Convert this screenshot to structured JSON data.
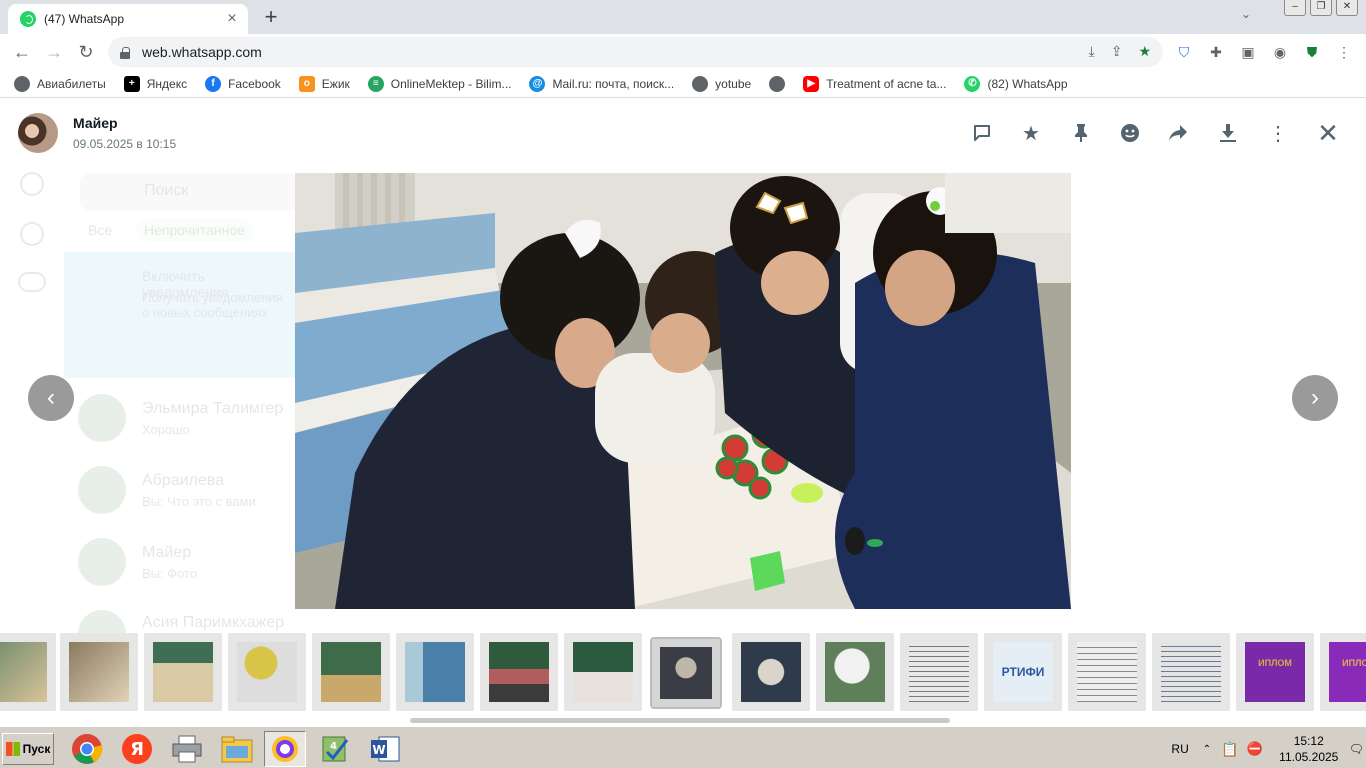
{
  "browser": {
    "tab_title": "(47) WhatsApp",
    "url": "web.whatsapp.com",
    "window_controls": [
      "minimize",
      "restore",
      "close"
    ]
  },
  "bookmarks": [
    {
      "label": "Авиабилеты",
      "icon": "globe-icon",
      "color": "#5f6368"
    },
    {
      "label": "Яндекс",
      "icon": "yandex-icon",
      "color": "#000000"
    },
    {
      "label": "Facebook",
      "icon": "facebook-icon",
      "color": "#1877f2"
    },
    {
      "label": "Ежик",
      "icon": "odnoklassniki-icon",
      "color": "#f7931e"
    },
    {
      "label": "OnlineMektep - Bilim...",
      "icon": "onlinemektep-icon",
      "color": "#25a55f"
    },
    {
      "label": "Mail.ru: почта, поиск...",
      "icon": "mailru-icon",
      "color": "#168de2"
    },
    {
      "label": "yotube",
      "icon": "globe-icon",
      "color": "#5f6368"
    },
    {
      "label": "",
      "icon": "globe-icon",
      "color": "#5f6368"
    },
    {
      "label": "Treatment of acne ta...",
      "icon": "youtube-icon",
      "color": "#ff0000"
    },
    {
      "label": "(82) WhatsApp",
      "icon": "whatsapp-icon",
      "color": "#25d366"
    }
  ],
  "viewer": {
    "sender": "Майер",
    "datetime": "09.05.2025 в 10:15",
    "actions": [
      "reply-icon",
      "star-icon",
      "pin-icon",
      "emoji-icon",
      "forward-icon",
      "download-icon",
      "menu-icon",
      "close-icon"
    ]
  },
  "background_chat": {
    "search_placeholder": "Поиск",
    "filters": [
      "Все",
      "Непрочитанное"
    ],
    "chats": [
      {
        "name": "Включить уведомления",
        "preview": "Получать уведомления о новых сообщениях"
      },
      {
        "name": "Эльмира Талимгер",
        "preview": "Хорошо"
      },
      {
        "name": "Абраилева",
        "preview": "Вы: Что это с вами"
      },
      {
        "name": "Майер",
        "preview": "Вы: Фото"
      },
      {
        "name": "Асия Паримкхажер",
        "preview": ""
      }
    ]
  },
  "thumbnails": [
    {
      "kind": "class-photo",
      "c1": "#6f8a6a",
      "c2": "#d7c49a"
    },
    {
      "kind": "class-photo",
      "c1": "#8a7a60",
      "c2": "#e0d3b6"
    },
    {
      "kind": "class-photo",
      "c1": "#3f6e55",
      "c2": "#d9c9a4"
    },
    {
      "kind": "class-photo",
      "c1": "#d8c548",
      "c2": "#ddd"
    },
    {
      "kind": "class-photo",
      "c1": "#3e6b4a",
      "c2": "#c9a96b"
    },
    {
      "kind": "class-photo",
      "c1": "#4a7fa8",
      "c2": "#a9c9d9"
    },
    {
      "kind": "class-photo",
      "c1": "#2f5a3d",
      "c2": "#b25d5d"
    },
    {
      "kind": "class-photo",
      "c1": "#2c5a3e",
      "c2": "#e7e3dc"
    },
    {
      "kind": "class-photo",
      "c1": "#3a3c46",
      "c2": "#bfb8a8",
      "selected": true
    },
    {
      "kind": "class-photo",
      "c1": "#2f3a4a",
      "c2": "#d9d5cc"
    },
    {
      "kind": "class-photo",
      "c1": "#5e7f5a",
      "c2": "#f1f1f1"
    },
    {
      "kind": "document",
      "c1": "#e8e8e8",
      "c2": "#7a7a7a"
    },
    {
      "kind": "certificate",
      "c1": "#e6eef5",
      "c2": "#2a5aa0",
      "text": "РТИФИ"
    },
    {
      "kind": "document",
      "c1": "#eeeeee",
      "c2": "#8a8a8a"
    },
    {
      "kind": "document",
      "c1": "#e4e4e4",
      "c2": "#6e7b8f"
    },
    {
      "kind": "diploma",
      "c1": "#7a2aa8",
      "c2": "#d9a94a",
      "text": "ИПЛОМ"
    },
    {
      "kind": "diploma",
      "c1": "#8a2ab8",
      "c2": "#e0b050",
      "text": "ИПЛОМ"
    }
  ],
  "taskbar": {
    "start_label": "Пуск",
    "apps": [
      "chrome-icon",
      "yandex-browser-icon",
      "printer-icon",
      "explorer-icon",
      "security-icon",
      "notepad-icon",
      "word-icon"
    ],
    "language": "RU",
    "time": "15:12",
    "date": "11.05.2025"
  }
}
